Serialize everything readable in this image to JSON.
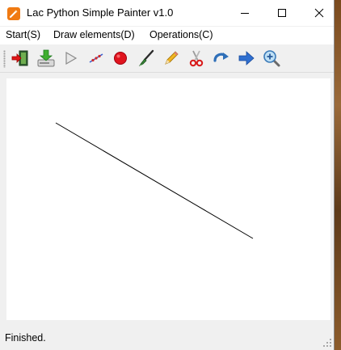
{
  "window": {
    "title": "Lac Python Simple Painter v1.0",
    "controls": {
      "minimize": "minimize",
      "maximize": "maximize",
      "close": "close"
    }
  },
  "menu": {
    "start": "Start(S)",
    "draw": "Draw elements(D)",
    "operations": "Operations(C)"
  },
  "toolbar": {
    "tools": [
      {
        "icon": "exit-icon"
      },
      {
        "icon": "save-download-icon"
      },
      {
        "icon": "play-arrow-icon"
      },
      {
        "icon": "line-draw-icon"
      },
      {
        "icon": "red-circle-icon"
      },
      {
        "icon": "brush-icon"
      },
      {
        "icon": "pencil-icon"
      },
      {
        "icon": "scissors-icon"
      },
      {
        "icon": "redo-arrow-icon"
      },
      {
        "icon": "forward-arrow-icon"
      },
      {
        "icon": "zoom-in-icon"
      }
    ]
  },
  "canvas": {
    "background": "#ffffff",
    "stroke_color": "#000000"
  },
  "status": {
    "text": "Finished."
  },
  "colors": {
    "app_icon": "#f07a12",
    "window_bg": "#f0f0f0",
    "titlebar_bg": "#ffffff"
  }
}
